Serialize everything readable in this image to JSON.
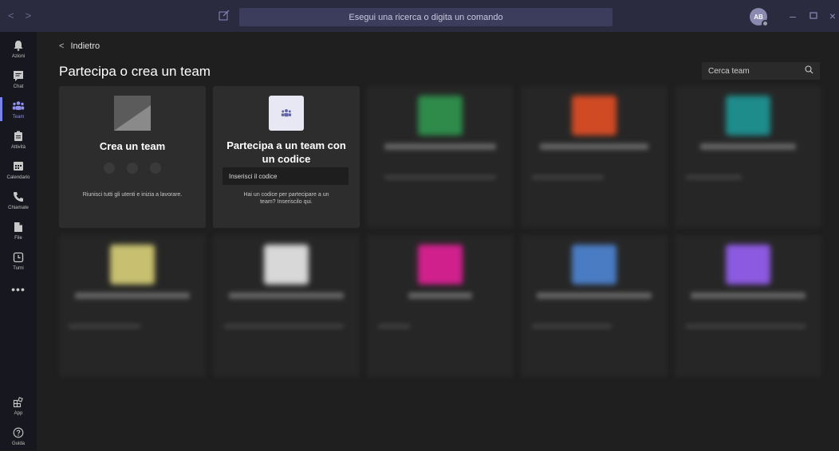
{
  "topbar": {
    "search_placeholder": "Esegui una ricerca o digita un comando",
    "avatar_initials": "AB"
  },
  "rail": {
    "items": [
      {
        "label": "Azioni",
        "icon": "bell-icon"
      },
      {
        "label": "Chat",
        "icon": "chat-icon"
      },
      {
        "label": "Team",
        "icon": "team-icon"
      },
      {
        "label": "Attività",
        "icon": "activity-icon"
      },
      {
        "label": "Calendario",
        "icon": "calendar-icon"
      },
      {
        "label": "Chiamate",
        "icon": "phone-icon"
      },
      {
        "label": "File",
        "icon": "file-icon"
      },
      {
        "label": "Turni",
        "icon": "shifts-icon"
      },
      {
        "label": "",
        "icon": "more-icon"
      }
    ],
    "bottom": [
      {
        "label": "App",
        "icon": "apps-icon"
      },
      {
        "label": "Guida",
        "icon": "help-icon"
      }
    ]
  },
  "main": {
    "back_label": "Indietro",
    "title": "Partecipa o crea un team",
    "team_search_placeholder": "Cerca team",
    "create_card": {
      "title": "Crea un team",
      "description": "Riunisci tutti gli utenti e inizia a lavorare."
    },
    "join_card": {
      "title": "Partecipa a un team con un codice",
      "input_placeholder": "Inserisci il codice",
      "description": "Hai un codice per partecipare a un team? Inseriscilo qui."
    },
    "blurred_teams": [
      {
        "color": "#2e8b4a"
      },
      {
        "color": "#d04a24"
      },
      {
        "color": "#1f8c8c"
      },
      {
        "color": "#c8c070"
      },
      {
        "color": "#d8d8d8"
      },
      {
        "color": "#d0208c"
      },
      {
        "color": "#4a7cc4"
      },
      {
        "color": "#8c5ae0"
      }
    ]
  }
}
